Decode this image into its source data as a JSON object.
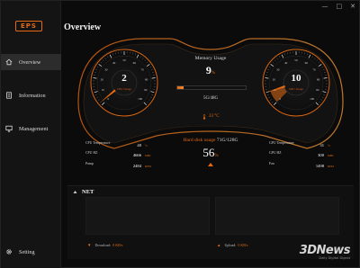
{
  "window": {
    "minimize": "—",
    "maximize": "□",
    "close": "✕"
  },
  "brand": {
    "logo_text": "EPS"
  },
  "sidebar": {
    "items": [
      {
        "label": "Overview",
        "icon": "home-icon",
        "active": true
      },
      {
        "label": "Information",
        "icon": "document-icon",
        "active": false
      },
      {
        "label": "Management",
        "icon": "monitor-icon",
        "active": false
      }
    ],
    "setting_label": "Setting",
    "setting_icon": "gear-icon"
  },
  "page": {
    "title": "Overview"
  },
  "gauges": {
    "cpu": {
      "value": "2",
      "label": "CPU Usage",
      "level": 0.02
    },
    "gpu": {
      "value": "10",
      "label": "GPU Usage",
      "level": 0.1
    },
    "scale": [
      "0",
      "10",
      "20",
      "30",
      "40",
      "50",
      "60",
      "70",
      "80",
      "90",
      "100"
    ]
  },
  "memory": {
    "title": "Memory Usage",
    "value": "9",
    "unit": "%",
    "size": "5G/48G",
    "level": 0.09
  },
  "temperature": {
    "value": "33",
    "unit": "°C"
  },
  "harddisk": {
    "title": "Hard disk usage",
    "size": "71G/128G",
    "value": "56",
    "unit": "%"
  },
  "cpu_stats": [
    {
      "label": "CPU Temperature",
      "value": "40",
      "unit": "°C"
    },
    {
      "label": "CPU HZ",
      "value": "4666",
      "unit": "MHz"
    },
    {
      "label": "Pump",
      "value": "2484",
      "unit": "RPM"
    }
  ],
  "gpu_stats": [
    {
      "label": "GPU Temperature",
      "value": "31",
      "unit": "°C"
    },
    {
      "label": "GPU HZ",
      "value": "300",
      "unit": "MHz"
    },
    {
      "label": "Fan",
      "value": "1498",
      "unit": "RPM"
    }
  ],
  "net": {
    "title": "NET",
    "download_label": "Download:",
    "download_value": "0 KB/s",
    "upload_label": "Upload:",
    "upload_value": "0 KB/s"
  },
  "watermark": {
    "logo": "3DNews",
    "tagline": "Daily Digital Digest"
  },
  "colors": {
    "accent": "#e36a12",
    "background": "#0b0b0b",
    "sidebar": "#141414"
  }
}
